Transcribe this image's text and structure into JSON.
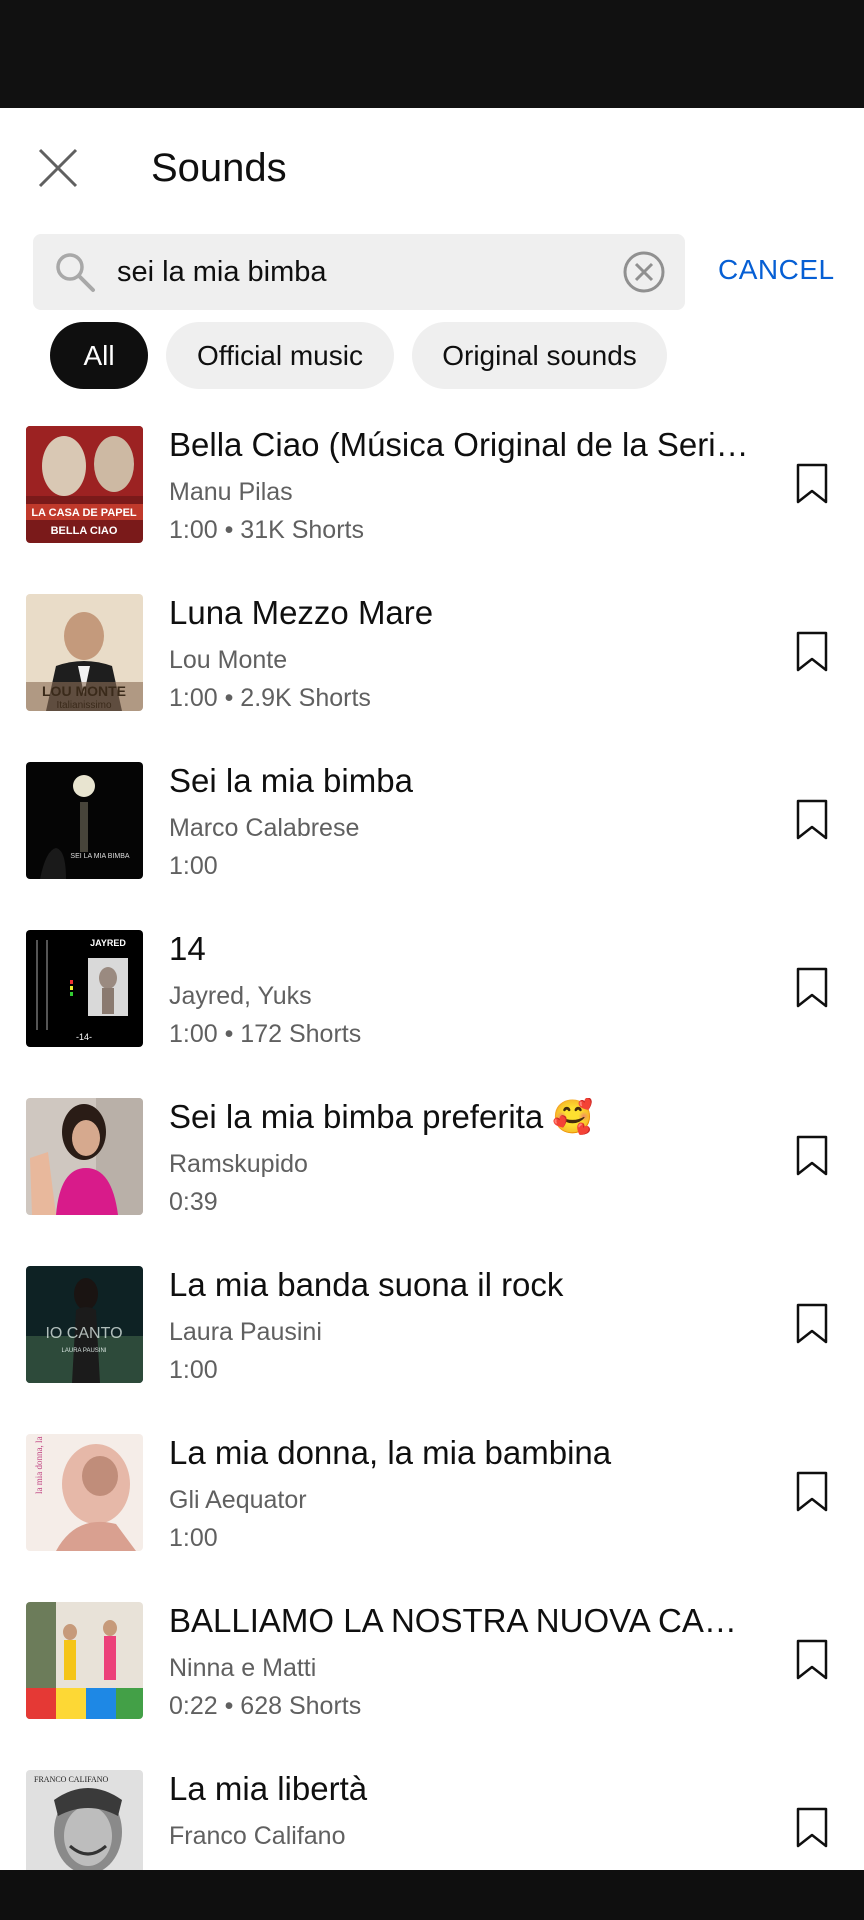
{
  "header": {
    "title": "Sounds"
  },
  "search": {
    "value": "sei la mia bimba",
    "cancel_label": "CANCEL"
  },
  "chips": [
    {
      "label": "All",
      "active": true
    },
    {
      "label": "Official music",
      "active": false
    },
    {
      "label": "Original sounds",
      "active": false
    }
  ],
  "results": [
    {
      "title": "Bella Ciao (Música Original de la Serie...",
      "artist": "Manu Pilas",
      "meta": "1:00 • 31K Shorts",
      "thumb_text": "BELLA CIAO",
      "thumb_brand": "LA CASA DE PAPEL"
    },
    {
      "title": "Luna Mezzo Mare",
      "artist": "Lou Monte",
      "meta": "1:00 • 2.9K Shorts",
      "thumb_text": "LOU MONTE",
      "thumb_sub": "Italianissimo"
    },
    {
      "title": "Sei la mia bimba",
      "artist": "Marco Calabrese",
      "meta": "1:00",
      "thumb_text": "SEI LA MIA BIMBA"
    },
    {
      "title": "14",
      "artist": "Jayred, Yuks",
      "meta": "1:00 • 172 Shorts",
      "thumb_text": "JAYRED",
      "thumb_sub": "-14-"
    },
    {
      "title": "Sei la mia bimba preferita 🥰",
      "artist": "Ramskupido",
      "meta": "0:39"
    },
    {
      "title": "La mia banda suona il rock",
      "artist": "Laura Pausini",
      "meta": "1:00",
      "thumb_text": "IO CANTO",
      "thumb_sub": "LAURA PAUSINI"
    },
    {
      "title": "La mia donna, la mia bambina",
      "artist": "Gli Aequator",
      "meta": "1:00",
      "thumb_text": "la mia donna, la mia bambina"
    },
    {
      "title": "BALLIAMO LA NOSTRA NUOVA CANZ...",
      "artist": "Ninna e Matti",
      "meta": "0:22 • 628 Shorts"
    },
    {
      "title": "La mia libertà",
      "artist": "Franco Califano",
      "meta": "",
      "thumb_text": "FRANCO CALIFANO"
    }
  ],
  "icons": {
    "close": "close-icon",
    "search": "search-icon",
    "clear": "clear-icon",
    "bookmark": "bookmark-icon"
  },
  "colors": {
    "accent": "#065fd4",
    "chip_active_bg": "#0f0f0f",
    "chip_bg": "#efefef",
    "secondary_text": "#606060"
  }
}
